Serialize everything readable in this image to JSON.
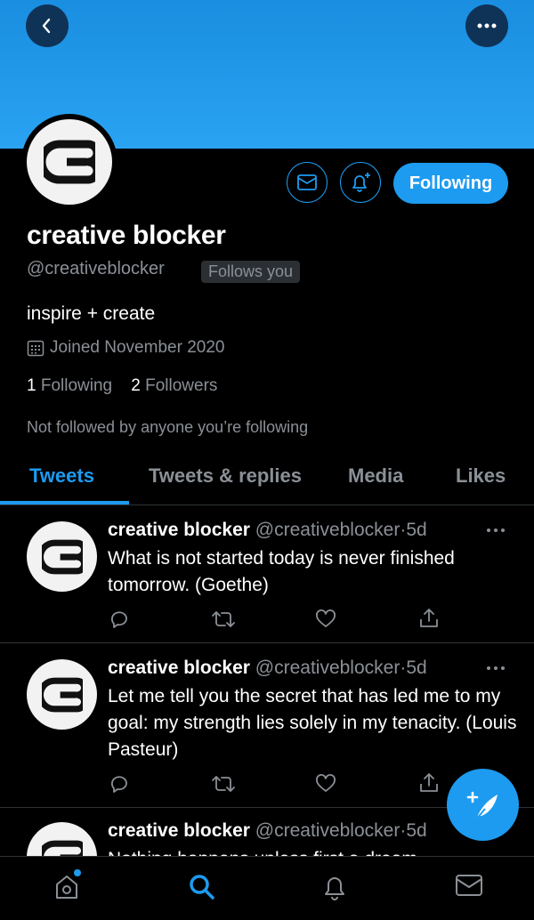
{
  "profile": {
    "name": "creative blocker",
    "handle": "@creativeblocker",
    "follows_you": "Follows you",
    "bio": "inspire + create",
    "joined": "Joined November 2020",
    "following_count": "1",
    "following_label": "Following",
    "followers_count": "2",
    "followers_label": "Followers",
    "not_followed": "Not followed by anyone you’re following",
    "following_button": "Following"
  },
  "tabs": [
    {
      "label": "Tweets",
      "active": true
    },
    {
      "label": "Tweets & replies"
    },
    {
      "label": "Media"
    },
    {
      "label": "Likes"
    }
  ],
  "tweets": [
    {
      "name": "creative blocker",
      "handle": "@creativeblocker",
      "time": "5d",
      "text": "What is not started today is never finished tomorrow. (Goethe)"
    },
    {
      "name": "creative blocker",
      "handle": "@creativeblocker",
      "time": "5d",
      "text": "Let me tell you the secret that has led me to my goal: my strength lies solely in my tenacity.  (Louis Pasteur)"
    },
    {
      "name": "creative blocker",
      "handle": "@creativeblocker",
      "time": "5d",
      "text": "Nothing happens unless first a dream."
    }
  ],
  "separator": "·",
  "colors": {
    "accent": "#1d9bf0",
    "background": "#000000",
    "muted": "#8b9096",
    "banner": "#2aa3f3"
  },
  "icons": [
    "back-icon",
    "more-icon",
    "mail-icon",
    "bell-plus-icon",
    "calendar-icon",
    "reply-icon",
    "retweet-icon",
    "like-icon",
    "share-icon",
    "compose-icon",
    "home-icon",
    "search-icon",
    "notifications-icon",
    "messages-icon"
  ]
}
